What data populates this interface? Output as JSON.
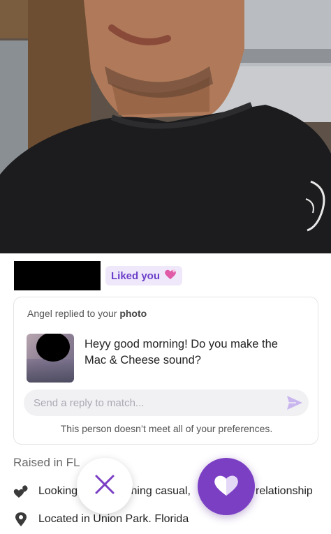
{
  "profile": {
    "photo_alt": "profile-photo",
    "liked_badge": {
      "label": "Liked you",
      "icon": "sparkle-heart-icon"
    }
  },
  "reply_card": {
    "title_prefix": "Angel replied to your ",
    "title_emphasis": "photo",
    "message": "Heyy good morning! Do you make the Mac & Cheese sound?",
    "reply_placeholder": "Send a reply to match...",
    "reply_value": "",
    "send_icon": "send-icon",
    "preference_note": "This person doesn’t meet all of your preferences."
  },
  "details": {
    "raised_in": "Raised in FL",
    "looking_left": "Looking",
    "looking_mid": "thing casual,",
    "looking_right": "relationship",
    "location": "Located in Union Park. Florida"
  },
  "actions": {
    "pass_icon": "close-icon",
    "like_icon": "heart-icon"
  },
  "colors": {
    "accent": "#7b3fc4",
    "badge_bg": "#efe8fb",
    "badge_text": "#6b3fc9",
    "field_bg": "#f1f1f4"
  }
}
